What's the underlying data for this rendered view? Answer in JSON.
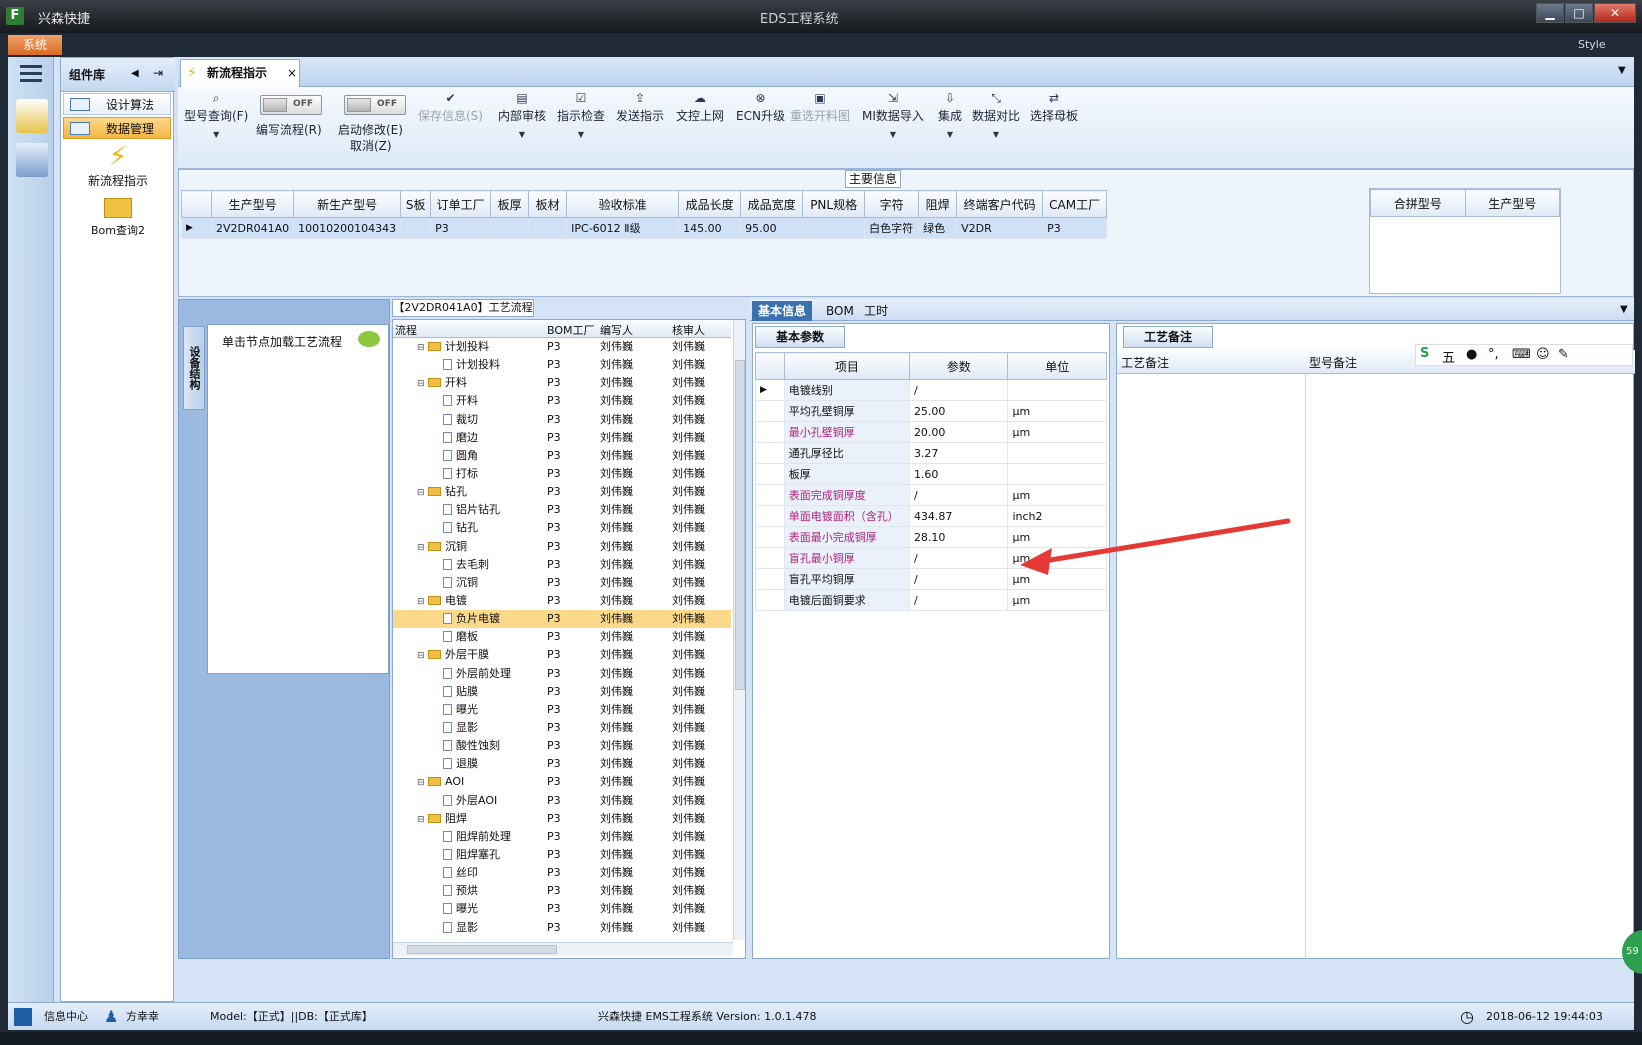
{
  "titlebar": {
    "app_name": "兴森快捷",
    "window_title": "EDS工程系统",
    "min": "▁",
    "max": "□",
    "close": "✕"
  },
  "system_menu": "系统",
  "style_label": "Style",
  "component_library": {
    "title": "组件库",
    "items": [
      {
        "label": "设计算法"
      },
      {
        "label": "数据管理"
      }
    ],
    "tools": [
      {
        "label": "新流程指示"
      },
      {
        "label": "Bom查询2"
      }
    ]
  },
  "tab": {
    "label": "新流程指示",
    "close": "×"
  },
  "ribbon": {
    "buttons": [
      {
        "label": "型号查询(F)",
        "icon": "search-icon"
      },
      {
        "label": "编写流程(R)",
        "icon": "toggle"
      },
      {
        "label": "启动修改(E)",
        "label2": "取消(Z)",
        "icon": "toggle"
      },
      {
        "label": "保存信息(S)",
        "icon": "check-icon"
      },
      {
        "label": "内部审核",
        "icon": "printer-icon"
      },
      {
        "label": "指示检查",
        "icon": "checkbox-icon"
      },
      {
        "label": "发送指示",
        "icon": "upload-icon"
      },
      {
        "label": "文控上网",
        "icon": "cloud-icon"
      },
      {
        "label": "ECN升级",
        "icon": "binoculars-icon"
      },
      {
        "label": "重选开料图",
        "icon": "image-icon"
      },
      {
        "label": "MI数据导入",
        "icon": "import-icon"
      },
      {
        "label": "集成",
        "icon": "download-icon"
      },
      {
        "label": "数据对比",
        "icon": "compare-icon"
      },
      {
        "label": "选择母板",
        "icon": "shuffle-icon"
      }
    ],
    "toggle_text": "OFF"
  },
  "main_info": {
    "caption": "主要信息",
    "columns": [
      "生产型号",
      "新生产型号",
      "S板",
      "订单工厂",
      "板厚",
      "板材",
      "验收标准",
      "成品长度",
      "成品宽度",
      "PNL规格",
      "字符",
      "阻焊",
      "终端客户代码",
      "CAM工厂"
    ],
    "row": [
      "2V2DR041A0",
      "10010200104343",
      "",
      "P3",
      "",
      "",
      "IPC-6012 Ⅱ级",
      "145.00",
      "95.00",
      "",
      "白色字符",
      "绿色",
      "V2DR",
      "P3"
    ],
    "right_columns": [
      "合拼型号",
      "生产型号"
    ]
  },
  "left_panel": {
    "vtab": "设备结构",
    "node_hint": "单击节点加载工艺流程"
  },
  "flow": {
    "caption": "【2V2DR041A0】工艺流程",
    "columns": [
      "流程",
      "BOM工厂",
      "编写人",
      "核审人"
    ],
    "rows": [
      {
        "name": "计划投料",
        "level": 0,
        "fac": "P3",
        "w": "刘伟巍",
        "r": "刘伟巍"
      },
      {
        "name": "计划投料",
        "level": 1,
        "fac": "P3",
        "w": "刘伟巍",
        "r": "刘伟巍"
      },
      {
        "name": "开料",
        "level": 0,
        "fac": "P3",
        "w": "刘伟巍",
        "r": "刘伟巍"
      },
      {
        "name": "开料",
        "level": 1,
        "fac": "P3",
        "w": "刘伟巍",
        "r": "刘伟巍"
      },
      {
        "name": "裁切",
        "level": 1,
        "fac": "P3",
        "w": "刘伟巍",
        "r": "刘伟巍"
      },
      {
        "name": "磨边",
        "level": 1,
        "fac": "P3",
        "w": "刘伟巍",
        "r": "刘伟巍"
      },
      {
        "name": "圆角",
        "level": 1,
        "fac": "P3",
        "w": "刘伟巍",
        "r": "刘伟巍"
      },
      {
        "name": "打标",
        "level": 1,
        "fac": "P3",
        "w": "刘伟巍",
        "r": "刘伟巍"
      },
      {
        "name": "钻孔",
        "level": 0,
        "fac": "P3",
        "w": "刘伟巍",
        "r": "刘伟巍"
      },
      {
        "name": "铝片钻孔",
        "level": 1,
        "fac": "P3",
        "w": "刘伟巍",
        "r": "刘伟巍"
      },
      {
        "name": "钻孔",
        "level": 1,
        "fac": "P3",
        "w": "刘伟巍",
        "r": "刘伟巍"
      },
      {
        "name": "沉铜",
        "level": 0,
        "fac": "P3",
        "w": "刘伟巍",
        "r": "刘伟巍"
      },
      {
        "name": "去毛刺",
        "level": 1,
        "fac": "P3",
        "w": "刘伟巍",
        "r": "刘伟巍"
      },
      {
        "name": "沉铜",
        "level": 1,
        "fac": "P3",
        "w": "刘伟巍",
        "r": "刘伟巍"
      },
      {
        "name": "电镀",
        "level": 0,
        "fac": "P3",
        "w": "刘伟巍",
        "r": "刘伟巍"
      },
      {
        "name": "负片电镀",
        "level": 1,
        "fac": "P3",
        "w": "刘伟巍",
        "r": "刘伟巍",
        "selected": true
      },
      {
        "name": "磨板",
        "level": 1,
        "fac": "P3",
        "w": "刘伟巍",
        "r": "刘伟巍"
      },
      {
        "name": "外层干膜",
        "level": 0,
        "fac": "P3",
        "w": "刘伟巍",
        "r": "刘伟巍"
      },
      {
        "name": "外层前处理",
        "level": 1,
        "fac": "P3",
        "w": "刘伟巍",
        "r": "刘伟巍"
      },
      {
        "name": "贴膜",
        "level": 1,
        "fac": "P3",
        "w": "刘伟巍",
        "r": "刘伟巍"
      },
      {
        "name": "曝光",
        "level": 1,
        "fac": "P3",
        "w": "刘伟巍",
        "r": "刘伟巍"
      },
      {
        "name": "显影",
        "level": 1,
        "fac": "P3",
        "w": "刘伟巍",
        "r": "刘伟巍"
      },
      {
        "name": "酸性蚀刻",
        "level": 1,
        "fac": "P3",
        "w": "刘伟巍",
        "r": "刘伟巍"
      },
      {
        "name": "退膜",
        "level": 1,
        "fac": "P3",
        "w": "刘伟巍",
        "r": "刘伟巍"
      },
      {
        "name": "AOI",
        "level": 0,
        "fac": "P3",
        "w": "刘伟巍",
        "r": "刘伟巍"
      },
      {
        "name": "外层AOI",
        "level": 1,
        "fac": "P3",
        "w": "刘伟巍",
        "r": "刘伟巍"
      },
      {
        "name": "阻焊",
        "level": 0,
        "fac": "P3",
        "w": "刘伟巍",
        "r": "刘伟巍"
      },
      {
        "name": "阻焊前处理",
        "level": 1,
        "fac": "P3",
        "w": "刘伟巍",
        "r": "刘伟巍"
      },
      {
        "name": "阻焊塞孔",
        "level": 1,
        "fac": "P3",
        "w": "刘伟巍",
        "r": "刘伟巍"
      },
      {
        "name": "丝印",
        "level": 1,
        "fac": "P3",
        "w": "刘伟巍",
        "r": "刘伟巍"
      },
      {
        "name": "预烘",
        "level": 1,
        "fac": "P3",
        "w": "刘伟巍",
        "r": "刘伟巍"
      },
      {
        "name": "曝光",
        "level": 1,
        "fac": "P3",
        "w": "刘伟巍",
        "r": "刘伟巍"
      },
      {
        "name": "显影",
        "level": 1,
        "fac": "P3",
        "w": "刘伟巍",
        "r": "刘伟巍"
      }
    ]
  },
  "detail": {
    "tabs": [
      "基本信息",
      "BOM",
      "工时"
    ],
    "params_caption": "基本参数",
    "param_columns": [
      "项目",
      "参数",
      "单位"
    ],
    "params": [
      {
        "item": "电镀线别",
        "value": "/",
        "unit": "",
        "pink": false
      },
      {
        "item": "平均孔壁铜厚",
        "value": "25.00",
        "unit": "μm",
        "pink": false
      },
      {
        "item": "最小孔壁铜厚",
        "value": "20.00",
        "unit": "μm",
        "pink": true
      },
      {
        "item": "通孔厚径比",
        "value": "3.27",
        "unit": "",
        "pink": false
      },
      {
        "item": "板厚",
        "value": "1.60",
        "unit": "",
        "pink": false
      },
      {
        "item": "表面完成铜厚度",
        "value": "/",
        "unit": "μm",
        "pink": true
      },
      {
        "item": "单面电镀面积（含孔）",
        "value": "434.87",
        "unit": "inch2",
        "pink": true
      },
      {
        "item": "表面最小完成铜厚",
        "value": "28.10",
        "unit": "μm",
        "pink": true
      },
      {
        "item": "盲孔最小铜厚",
        "value": "/",
        "unit": "μm",
        "pink": true
      },
      {
        "item": "盲孔平均铜厚",
        "value": "/",
        "unit": "μm",
        "pink": false
      },
      {
        "item": "电镀后面铜要求",
        "value": "/",
        "unit": "μm",
        "pink": false
      }
    ],
    "notes_caption": "工艺备注",
    "notes_columns": [
      "工艺备注",
      "型号备注"
    ],
    "ime": "五"
  },
  "statusbar": {
    "info_center": "信息中心",
    "user": "方幸幸",
    "model": "Model:【正式】||DB:【正式库】",
    "version": "兴森快捷 EMS工程系统 Version: 1.0.1.478",
    "datetime": "2018-06-12 19:44:03"
  },
  "badge": "59",
  "colors": {
    "accent_orange": "#f3b646",
    "selected_row": "#fbd98a",
    "pink_text": "#b0237e",
    "arrow": "#e53935"
  }
}
